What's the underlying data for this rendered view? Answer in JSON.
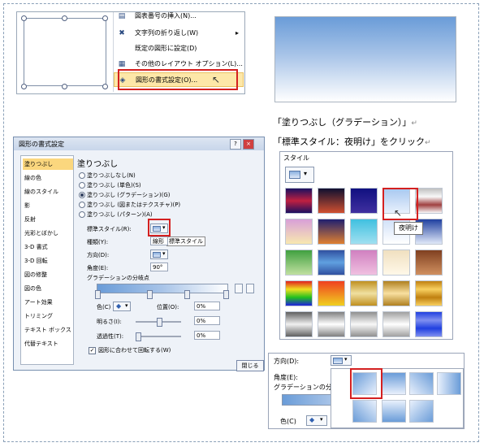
{
  "context_menu": {
    "items": [
      {
        "icon": "caption-icon",
        "label": "図表番号の挿入(N)..."
      },
      {
        "icon": "text-wrap-icon",
        "label": "文字列の折り返し(W)",
        "arrow": "▸"
      },
      {
        "icon": "",
        "label": "既定の図形に設定(D)"
      },
      {
        "icon": "layout-icon",
        "label": "その他のレイアウト オプション(L)..."
      },
      {
        "icon": "format-shape-icon",
        "label": "図形の書式設定(O)..."
      }
    ]
  },
  "caption": {
    "line1": "「塗りつぶし（グラデーション）」",
    "line2": "「標準スタイル：夜明け」をクリック",
    "mark": "↵"
  },
  "dialog": {
    "title": "図形の書式設定",
    "help": "?",
    "close_x": "×",
    "nav": [
      "塗りつぶし",
      "線の色",
      "線のスタイル",
      "影",
      "反射",
      "光彩とぼかし",
      "3-D 書式",
      "3-D 回転",
      "図の修整",
      "図の色",
      "アート効果",
      "トリミング",
      "テキスト ボックス",
      "代替テキスト"
    ],
    "section": "塗りつぶし",
    "options": [
      "塗りつぶしなし(N)",
      "塗りつぶし (単色)(S)",
      "塗りつぶし (グラデーション)(G)",
      "塗りつぶし (図またはテクスチャ)(P)",
      "塗りつぶし (パターン)(A)"
    ],
    "preset_label": "標準スタイル(R):",
    "type_label": "種類(Y):",
    "type_value": "線形",
    "preset_tooltip": "標準スタイル",
    "direction_label": "方向(D):",
    "angle_label": "角度(E):",
    "angle_value": "90°",
    "stops_label": "グラデーションの分岐点",
    "color_label": "色(C)",
    "position_label": "位置(O):",
    "position_value": "0%",
    "brightness_label": "明るさ(I):",
    "brightness_value": "0%",
    "transparency_label": "透過性(T):",
    "transparency_value": "0%",
    "rotate_label": "図形に合わせて回転する(W)",
    "close_button": "閉じる"
  },
  "gallery": {
    "header": "スタイル",
    "tooltip": "夜明け",
    "tiles": [
      "linear-gradient(#1a1060,#c02040,#1a1060)",
      "linear-gradient(#101030,#d05030)",
      "linear-gradient(#101080,#4030a0)",
      "linear-gradient(#a8c8f0,#e8f0fc)",
      "linear-gradient(#c0c0c0,#f8f8f8,#a04040,#f8f8f8)",
      "linear-gradient(#d8a0d8,#f8e8b0)",
      "linear-gradient(#202070,#e08030)",
      "linear-gradient(#40c0e0,#a0e0f0)",
      "linear-gradient(#d0e0f8,#ffffff)",
      "linear-gradient(#2040a0,#e0e8f8)",
      "linear-gradient(#40a040,#c0e0a0)",
      "linear-gradient(#3050a0,#60a0e0,#3050a0)",
      "linear-gradient(#d080c0,#f0c0e0)",
      "linear-gradient(#f0e0c0,#fff8e8)",
      "linear-gradient(#804020,#d09060)",
      "linear-gradient(#e02020,#f0e020,#20c020,#2020e0)",
      "linear-gradient(#f04020,#f0d020)",
      "linear-gradient(#c09020,#f0e0a0,#c09020)",
      "linear-gradient(#b08020,#f8e0a0,#b08020)",
      "linear-gradient(#c08010,#f8d060,#c08010,#f8d060)",
      "linear-gradient(#606060,#f0f0f0,#606060)",
      "linear-gradient(#808080,#ffffff,#808080)",
      "linear-gradient(#909090,#f8f8f8,#909090)",
      "linear-gradient(#a0a0a0,#ffffff,#a0a0a0)",
      "linear-gradient(#2040e0,#8090f0,#2040e0,#8090f0)"
    ]
  },
  "direction": {
    "label": "方向(D):",
    "angle_label": "角度(E):",
    "stops_label": "グラデーションの分岐",
    "color_label": "色(C)"
  },
  "colors": {
    "accent_red": "#d42020",
    "highlight": "#fde7a8",
    "nav_selected": "#fbd77e"
  }
}
